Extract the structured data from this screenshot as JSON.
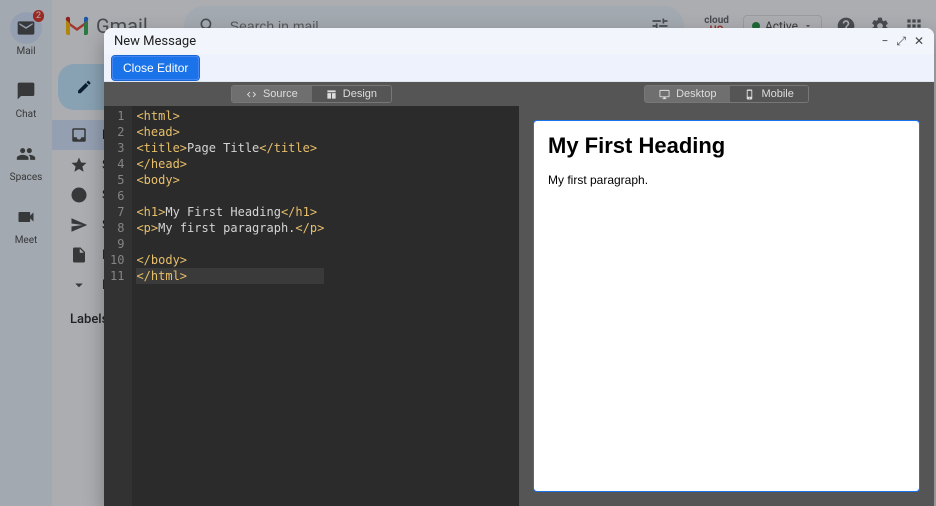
{
  "rail": {
    "mail": "Mail",
    "chat": "Chat",
    "spaces": "Spaces",
    "meet": "Meet",
    "badge": "2"
  },
  "header": {
    "brand": "Gmail",
    "search_placeholder": "Search in mail",
    "hq_label": "HQ",
    "active_label": "Active"
  },
  "sidebar": {
    "compose": "Compose",
    "items": [
      {
        "label": "Inbox"
      },
      {
        "label": "Starred"
      },
      {
        "label": "Snoozed"
      },
      {
        "label": "Sent"
      },
      {
        "label": "Drafts"
      },
      {
        "label": "More"
      }
    ],
    "labels_header": "Labels"
  },
  "modal": {
    "title": "New Message",
    "close_editor": "Close Editor",
    "tabs": {
      "source": "Source",
      "design": "Design",
      "desktop": "Desktop",
      "mobile": "Mobile"
    }
  },
  "code": {
    "lines": [
      {
        "n": "1",
        "tag_open": "<html>",
        "txt": "",
        "tag_close": ""
      },
      {
        "n": "2",
        "tag_open": "<head>",
        "txt": "",
        "tag_close": ""
      },
      {
        "n": "3",
        "tag_open": "<title>",
        "txt": "Page Title",
        "tag_close": "</title>"
      },
      {
        "n": "4",
        "tag_open": "</head>",
        "txt": "",
        "tag_close": ""
      },
      {
        "n": "5",
        "tag_open": "<body>",
        "txt": "",
        "tag_close": ""
      },
      {
        "n": "6",
        "tag_open": "",
        "txt": "",
        "tag_close": ""
      },
      {
        "n": "7",
        "tag_open": "<h1>",
        "txt": "My First Heading",
        "tag_close": "</h1>"
      },
      {
        "n": "8",
        "tag_open": "<p>",
        "txt": "My first paragraph.",
        "tag_close": "</p>"
      },
      {
        "n": "9",
        "tag_open": "",
        "txt": "",
        "tag_close": ""
      },
      {
        "n": "10",
        "tag_open": "</body>",
        "txt": "",
        "tag_close": ""
      },
      {
        "n": "11",
        "tag_open": "</html>",
        "txt": "",
        "tag_close": ""
      }
    ]
  },
  "preview": {
    "heading": "My First Heading",
    "paragraph": "My first paragraph."
  }
}
